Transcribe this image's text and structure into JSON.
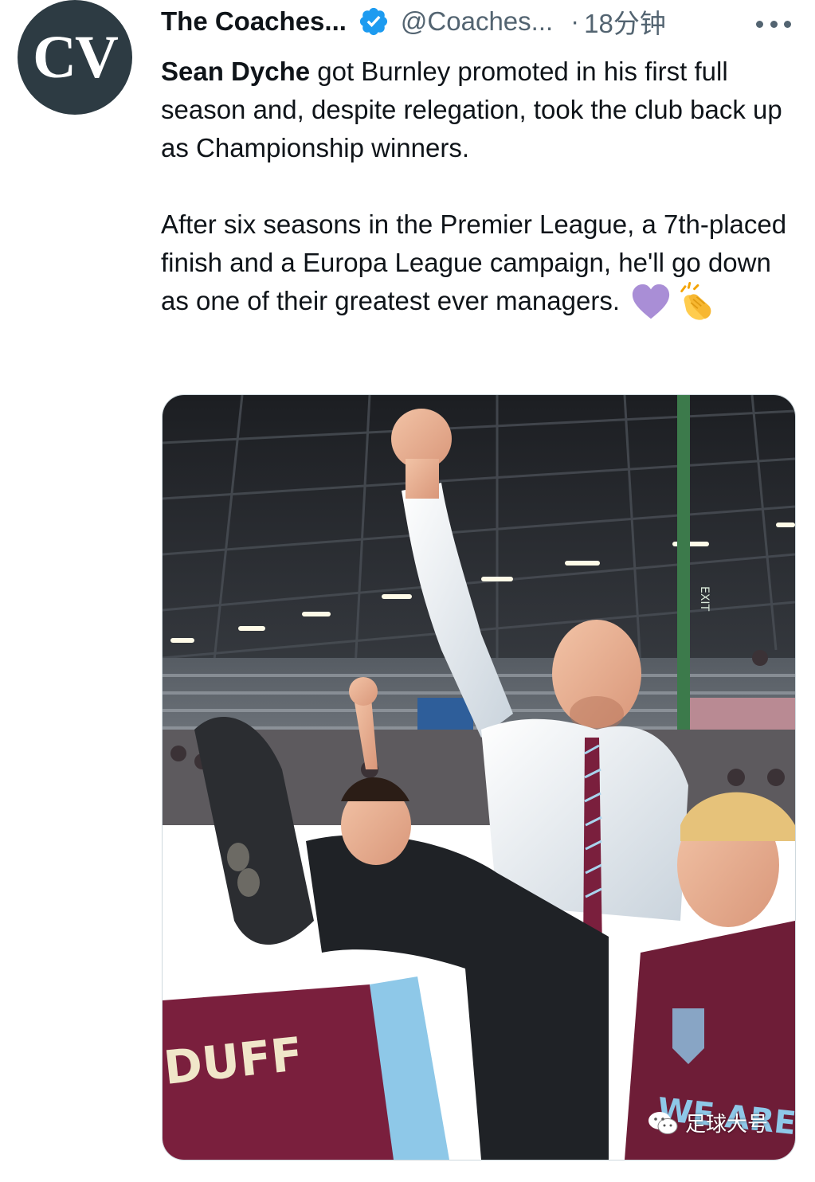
{
  "author": {
    "avatar_text": "CV",
    "display_name": "The Coaches...",
    "handle": "@Coaches...",
    "separator": "·",
    "timestamp": "18分钟",
    "verified_color": "#1d9bf0"
  },
  "tweet": {
    "mention": "Sean Dyche",
    "para1_rest": " got Burnley promoted in his first full season and, despite relegation, took the club back up as Championship winners.",
    "para2": "After six seasons in the Premier League, a 7th-placed finish and a Europa League campaign, he'll go down as one of their greatest ever managers.",
    "emojis": [
      "purple-heart-icon",
      "clapping-hands-icon"
    ]
  },
  "media": {
    "jersey_text": "DUFF",
    "shirt_text": "WE ARE",
    "exit_sign": "EXIT"
  },
  "watermark": {
    "text": "足球大号",
    "icon": "wechat-icon"
  },
  "colors": {
    "text_primary": "#0f1419",
    "text_secondary": "#536471",
    "claret": "#7a1f3d",
    "sky_blue": "#8ec8e8"
  }
}
